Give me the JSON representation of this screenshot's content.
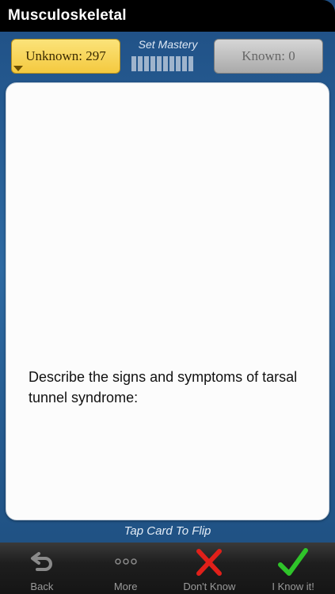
{
  "header": {
    "title": "Musculoskeletal"
  },
  "counters": {
    "unknown_label": "Unknown: 297",
    "known_label": "Known: 0",
    "mastery_label": "Set Mastery"
  },
  "card": {
    "question": "Describe the signs and symptoms of tarsal tunnel syndrome:"
  },
  "hint": "Tap Card To Flip",
  "toolbar": {
    "items": [
      {
        "label": "Back",
        "icon": "back-arrow-icon"
      },
      {
        "label": "More",
        "icon": "more-dots-icon"
      },
      {
        "label": "Don't Know",
        "icon": "red-x-icon"
      },
      {
        "label": "I Know it!",
        "icon": "green-check-icon"
      }
    ]
  },
  "colors": {
    "unknown_bg": "#f4c93f",
    "known_bg": "#a9a9a9",
    "dont_know": "#e0201a",
    "know_it": "#2fc42a"
  }
}
